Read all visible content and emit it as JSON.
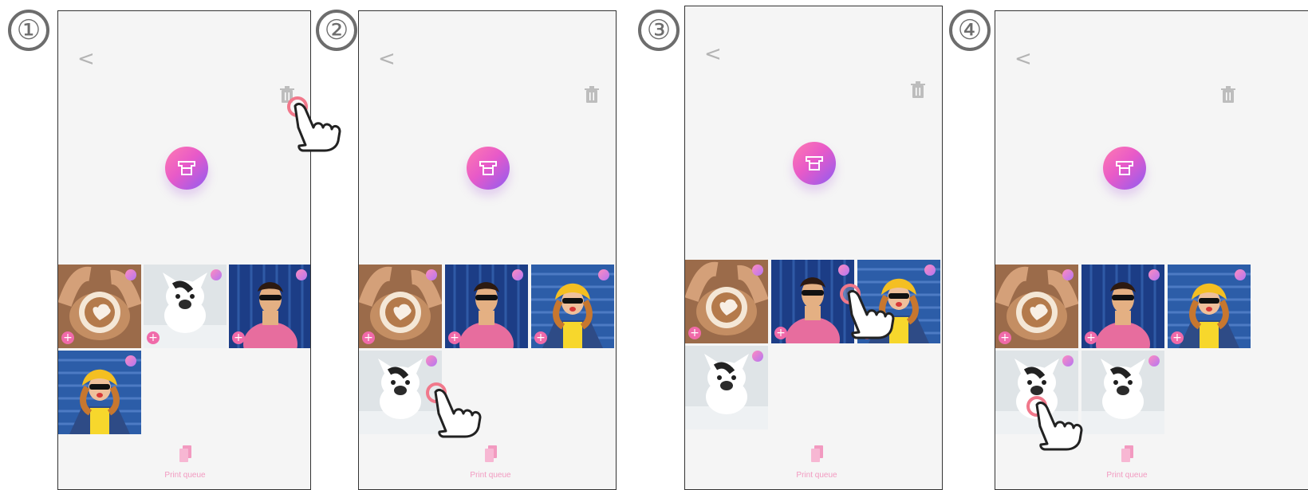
{
  "steps": [
    {
      "number_label": "①"
    },
    {
      "number_label": "②"
    },
    {
      "number_label": "③"
    },
    {
      "number_label": "④"
    }
  ],
  "screens": [
    {
      "back_label": "<",
      "footer_label": "Print queue",
      "tiles": [
        {
          "name": "coffee",
          "add_label": "+"
        },
        {
          "name": "dog",
          "add_label": "+"
        },
        {
          "name": "man",
          "add_label": "+"
        },
        {
          "name": "woman",
          "add_label": "+"
        }
      ]
    },
    {
      "back_label": "<",
      "footer_label": "Print queue",
      "tiles": [
        {
          "name": "coffee",
          "add_label": "+"
        },
        {
          "name": "man",
          "add_label": "+"
        },
        {
          "name": "woman",
          "add_label": "+"
        },
        {
          "name": "dog",
          "add_label": "+"
        }
      ]
    },
    {
      "back_label": "<",
      "footer_label": "Print queue",
      "tiles": [
        {
          "name": "coffee",
          "add_label": "+"
        },
        {
          "name": "man",
          "add_label": "+"
        },
        {
          "name": "woman",
          "add_label": "+"
        },
        {
          "name": "dog",
          "add_label": "+"
        }
      ]
    },
    {
      "back_label": "<",
      "footer_label": "Print queue",
      "tiles": [
        {
          "name": "coffee",
          "add_label": "+"
        },
        {
          "name": "man",
          "add_label": "+"
        },
        {
          "name": "woman",
          "add_label": "+"
        },
        {
          "name": "dog",
          "add_label": "+"
        },
        {
          "name": "dog",
          "add_label": "+"
        }
      ]
    }
  ],
  "icons": {
    "back": "chevron-left-icon",
    "trash": "trash-icon",
    "printer": "printer-icon",
    "queue": "print-queue-icon",
    "hand": "pointing-hand-icon"
  },
  "colors": {
    "screen_bg": "#f5f5f5",
    "accent": "#f06aa9",
    "tap_ring": "#f1788b"
  }
}
